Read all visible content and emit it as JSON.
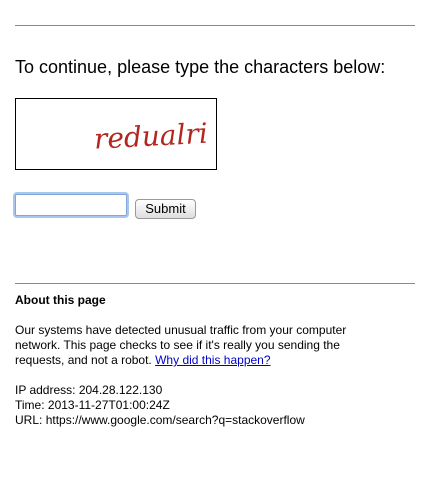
{
  "prompt": "To continue, please type the characters below:",
  "captcha": {
    "text": "redualri",
    "color": "#b3261e"
  },
  "form": {
    "input_value": "",
    "input_placeholder": "",
    "submit_label": "Submit"
  },
  "about": {
    "heading": "About this page",
    "line1": "Our systems have detected unusual traffic from your computer",
    "line2": "network. This page checks to see if it's really you sending the",
    "line3_text": "requests, and not a robot.",
    "link_text": "Why did this happen?"
  },
  "details": {
    "ip_label": "IP address:",
    "ip_value": "204.28.122.130",
    "time_label": "Time:",
    "time_value": "2013-11-27T01:00:24Z",
    "url_label": "URL:",
    "url_value": "https://www.google.com/search?q=stackoverflow"
  },
  "colors": {
    "link": "#0000cc",
    "input_focus": "#a9c6ee",
    "rule": "#8a8a8a"
  }
}
